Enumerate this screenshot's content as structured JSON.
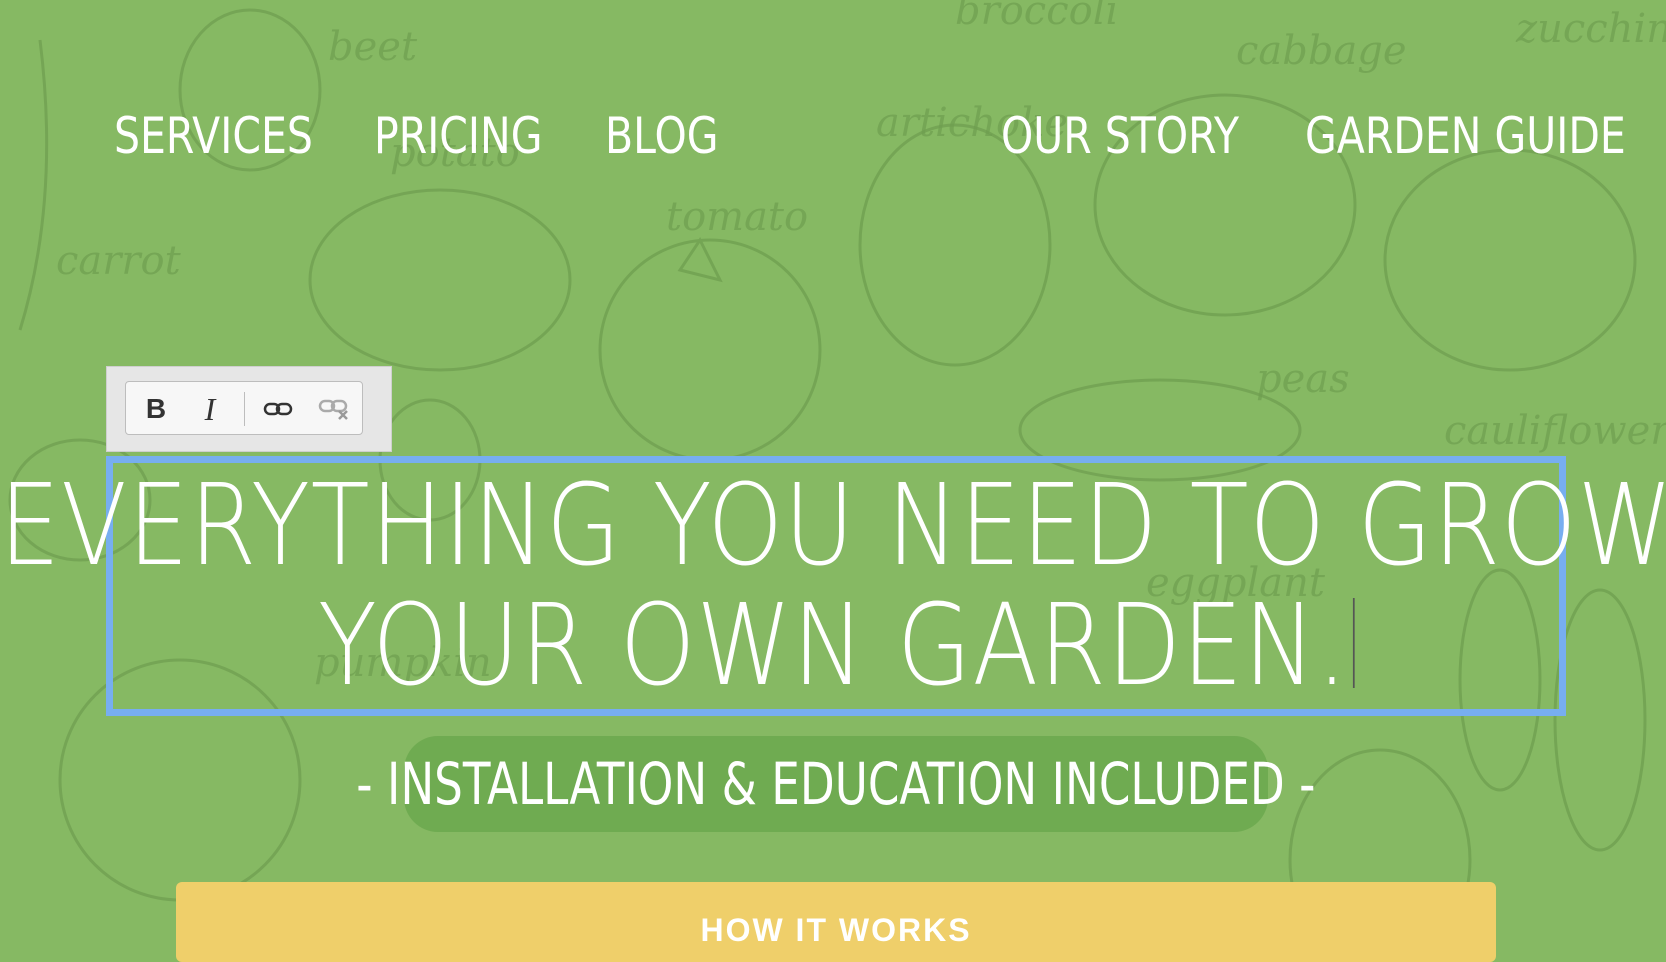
{
  "nav": {
    "items": [
      {
        "label": "Services"
      },
      {
        "label": "Pricing"
      },
      {
        "label": "Blog"
      },
      {
        "label": "Our Story"
      },
      {
        "label": "Garden Guide"
      }
    ]
  },
  "background": {
    "labels": [
      "beet",
      "broccoli",
      "cabbage",
      "zucchini",
      "carrot",
      "potato",
      "tomato",
      "artichoke",
      "peas",
      "cauliflower",
      "eggplant",
      "pumpkin"
    ]
  },
  "editor_toolbar": {
    "bold_label": "B",
    "italic_label": "I",
    "icons": [
      "bold-icon",
      "italic-icon",
      "link-icon",
      "unlink-icon"
    ]
  },
  "hero": {
    "headline_line1": "Everything you need to grow",
    "headline_line2": "your own garden.",
    "subtitle": "- Installation & Education Included -"
  },
  "cta": {
    "label": "HOW IT WORKS"
  },
  "colors": {
    "background": "#86b963",
    "selection_border": "#77aef0",
    "cta_background": "#efcf6a"
  }
}
